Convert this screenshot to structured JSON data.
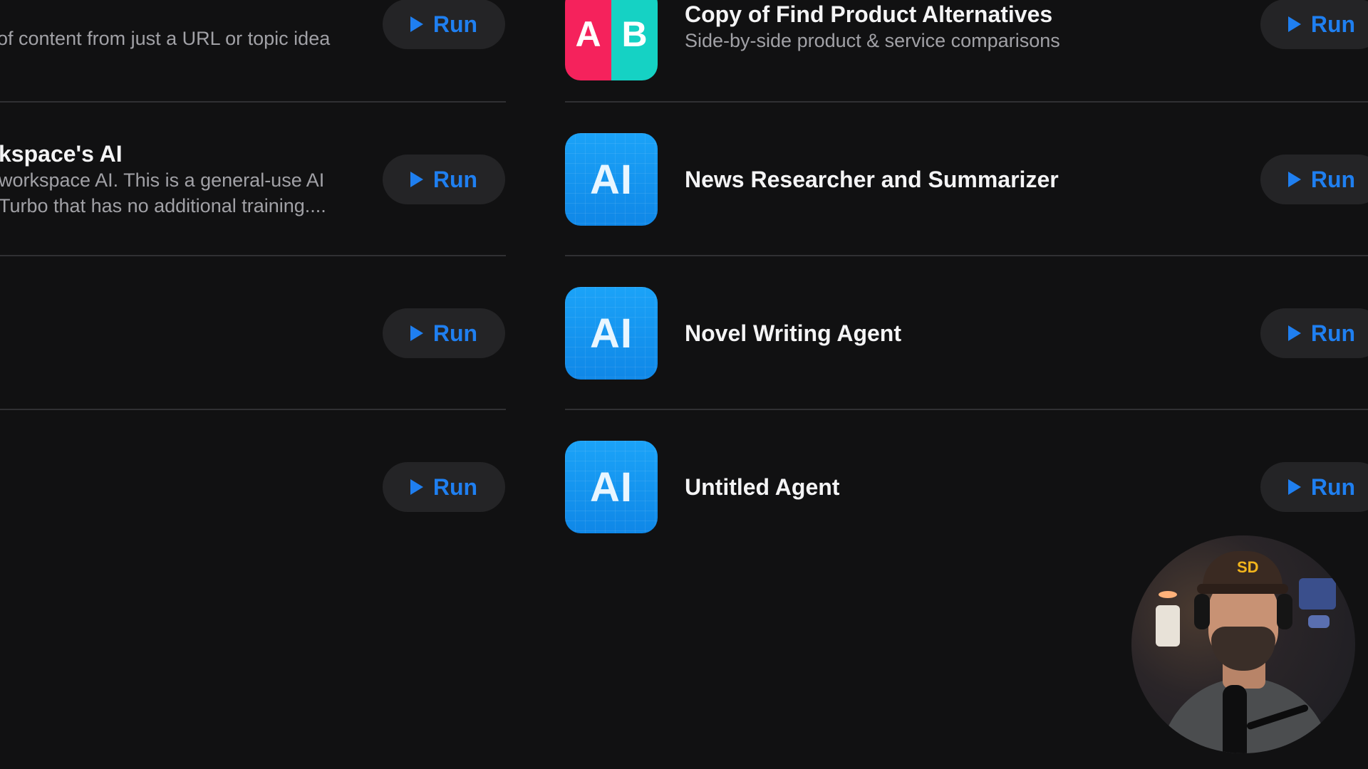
{
  "left_column": {
    "rows": [
      {
        "title": "",
        "description_lines": [
          "of content from just a URL or topic idea"
        ],
        "run_label": "Run"
      },
      {
        "title": "kspace's AI",
        "description_lines": [
          "workspace AI. This is a general-use AI",
          "Turbo that has no additional training...."
        ],
        "run_label": "Run"
      },
      {
        "title": "",
        "description_lines": [],
        "run_label": "Run"
      },
      {
        "title": "",
        "description_lines": [],
        "run_label": "Run"
      }
    ]
  },
  "right_column": {
    "rows": [
      {
        "icon": "ab-icon",
        "icon_letters": [
          "A",
          "B"
        ],
        "title": "Copy of Find Product Alternatives",
        "description": "Side-by-side product & service comparisons",
        "run_label": "Run"
      },
      {
        "icon": "ai-icon",
        "icon_text": "AI",
        "title": "News Researcher and Summarizer",
        "description": "",
        "run_label": "Run"
      },
      {
        "icon": "ai-icon",
        "icon_text": "AI",
        "title": "Novel Writing Agent",
        "description": "",
        "run_label": "Run"
      },
      {
        "icon": "ai-icon",
        "icon_text": "AI",
        "title": "Untitled Agent",
        "description": "",
        "run_label": "Run"
      }
    ]
  },
  "webcam": {
    "cap_logo": "SD"
  },
  "colors": {
    "background": "#111112",
    "accent_blue": "#1f7ff0",
    "button_bg": "#242426",
    "ai_icon_blue": "#1aa2f7",
    "ab_icon_pink": "#f5225c",
    "ab_icon_teal": "#15d2c4"
  }
}
